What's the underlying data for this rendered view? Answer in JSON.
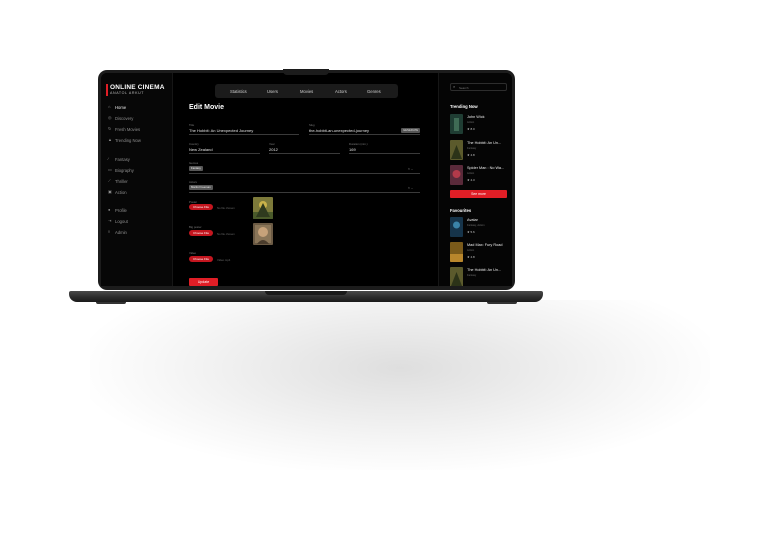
{
  "brand": {
    "title": "ONLINE CINEMA",
    "subtitle": "ANATOL ARKUT",
    "accent": "#e01e26"
  },
  "sidebar": {
    "items": [
      {
        "label": "Home",
        "icon": "home-icon"
      },
      {
        "label": "Discovery",
        "icon": "compass-icon"
      },
      {
        "label": "Fresh Movies",
        "icon": "refresh-icon"
      },
      {
        "label": "Trending Now",
        "icon": "fire-icon"
      },
      {
        "label": "Fantasy",
        "icon": "wand-icon"
      },
      {
        "label": "Biography",
        "icon": "book-icon"
      },
      {
        "label": "Thriller",
        "icon": "knife-icon"
      },
      {
        "label": "Action",
        "icon": "film-icon"
      },
      {
        "label": "Profile",
        "icon": "user-icon"
      },
      {
        "label": "Logout",
        "icon": "logout-icon"
      },
      {
        "label": "Admin",
        "icon": "shield-icon"
      }
    ]
  },
  "topnav": {
    "tabs": [
      "Statistics",
      "Users",
      "Movies",
      "Actors",
      "Genres"
    ]
  },
  "form": {
    "title": "Edit Movie",
    "fields": {
      "title": {
        "label": "Title",
        "value": "The Hobbit: An Unexpected Journey"
      },
      "slug": {
        "label": "Slug",
        "value": "the-hobbit-an-unexpected-journey",
        "button": "GENERATE"
      },
      "country": {
        "label": "Country",
        "value": "New Zealand"
      },
      "year": {
        "label": "Year",
        "value": "2012"
      },
      "duration": {
        "label": "Duration (min.)",
        "value": "169"
      },
      "genres": {
        "label": "Genres",
        "chip": "Fantasy"
      },
      "actors": {
        "label": "Actors",
        "chip": "Martin Freeman"
      },
      "poster": {
        "label": "Poster",
        "button": "Choose File",
        "file": "No file chosen"
      },
      "big_poster": {
        "label": "Big poster",
        "button": "Choose File",
        "file": "No file chosen"
      },
      "video": {
        "label": "Video",
        "button": "Choose File",
        "file": "Video.mp4"
      }
    },
    "update": "Update"
  },
  "right": {
    "search": {
      "placeholder": "Search"
    },
    "trending": {
      "heading": "Trending Now",
      "items": [
        {
          "title": "John Wick",
          "genre": "Action",
          "rating": "8.0"
        },
        {
          "title": "The Hobbit: An Un...",
          "genre": "Fantasy",
          "rating": "4.8"
        },
        {
          "title": "Spider Man : No Wa...",
          "genre": "Action",
          "rating": "4.3"
        }
      ],
      "see_more": "See more"
    },
    "favourites": {
      "heading": "Favourites",
      "items": [
        {
          "title": "Avatar",
          "genre": "Fantasy, Action",
          "rating": "5.6"
        },
        {
          "title": "Mad Max: Fury Road",
          "genre": "Action",
          "rating": "4.8"
        },
        {
          "title": "The Hobbit: An Un...",
          "genre": "Fantasy",
          "rating": ""
        }
      ]
    }
  }
}
